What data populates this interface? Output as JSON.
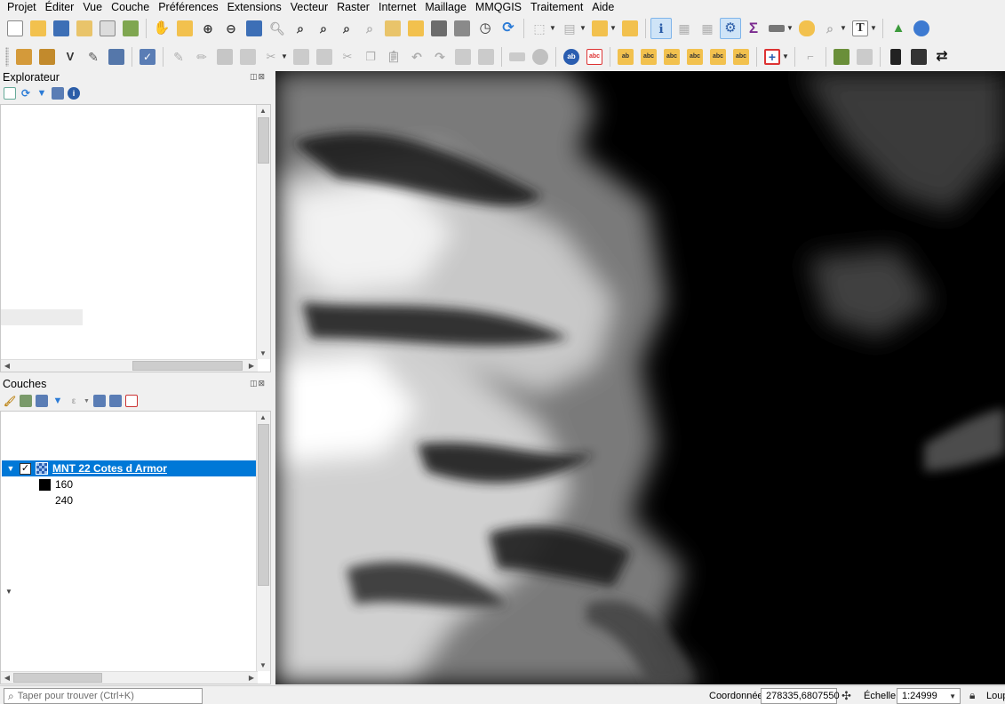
{
  "menu": [
    "Projet",
    "Éditer",
    "Vue",
    "Couche",
    "Préférences",
    "Extensions",
    "Vecteur",
    "Raster",
    "Internet",
    "Maillage",
    "MMQGIS",
    "Traitement",
    "Aide"
  ],
  "toolbar1": {
    "plugin_sigma": "Σ",
    "text_tool": "T"
  },
  "explorer": {
    "title": "Explorateur"
  },
  "layers": {
    "title": "Couches",
    "layer_name": "MNT 22 Cotes d Armor",
    "legend": [
      {
        "label": "160",
        "color": "#000000"
      },
      {
        "label": "240",
        "color": "#ffffff"
      }
    ]
  },
  "statusbar": {
    "locator_placeholder": "Taper pour trouver (Ctrl+K)",
    "coord_label": "Coordonnée",
    "coord_value": "278335,6807550",
    "scale_label": "Échelle",
    "scale_value": "1:24999",
    "lock_label": "Loup"
  },
  "colors": {
    "selection": "#0078d7",
    "panel_bg": "#f0f0f0",
    "map_bg": "#000000"
  }
}
